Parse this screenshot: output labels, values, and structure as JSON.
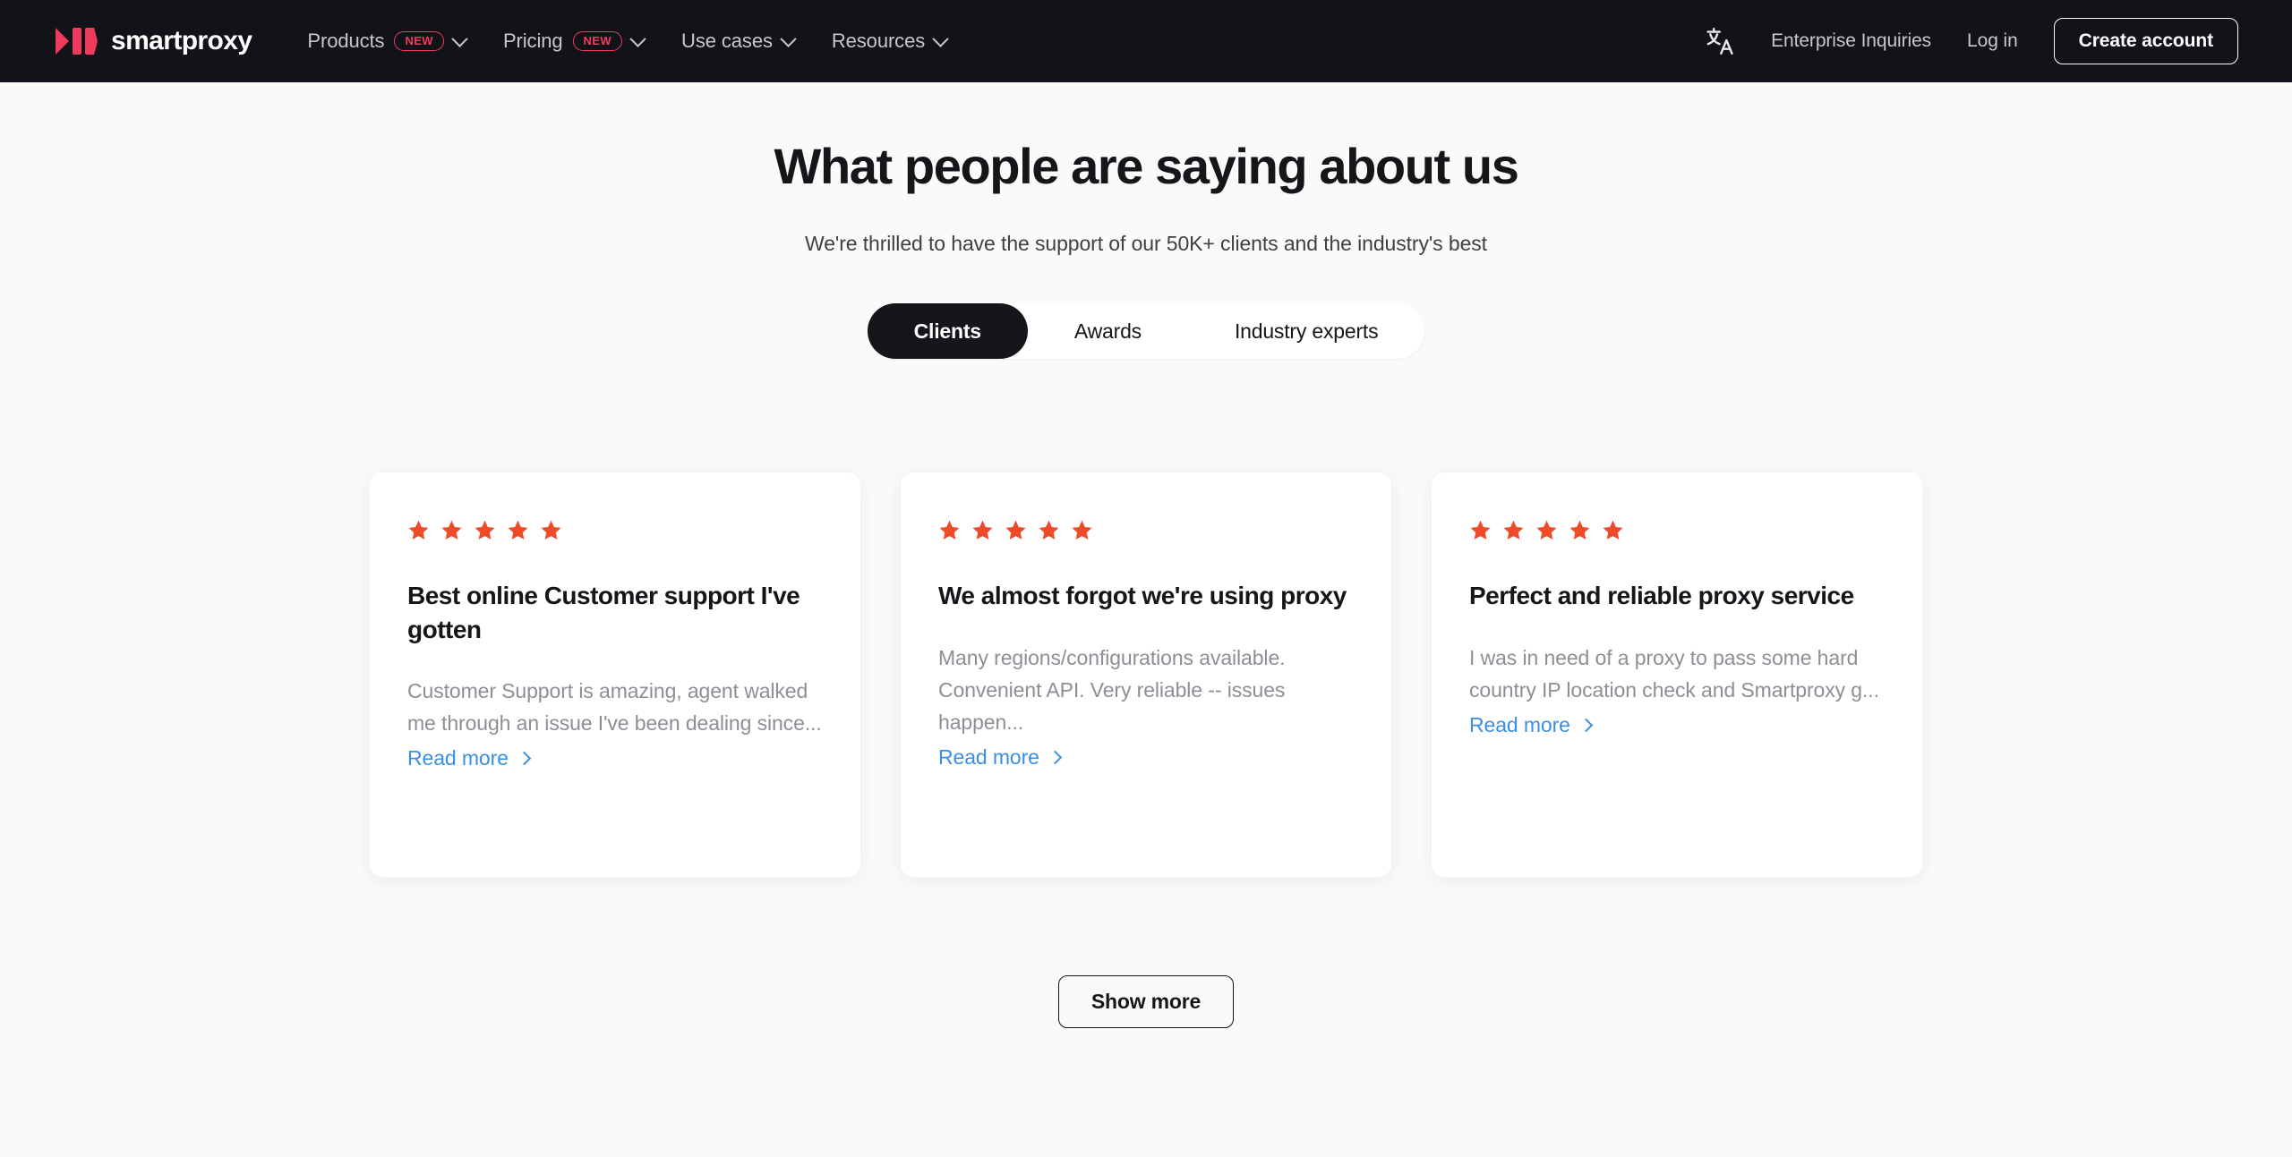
{
  "navbar": {
    "logo_text": "smartproxy",
    "logo_icon": "smartproxy-logo-mark",
    "menu": [
      {
        "label": "Products",
        "badge": "NEW",
        "has_chevron": true
      },
      {
        "label": "Pricing",
        "badge": "NEW",
        "has_chevron": true
      },
      {
        "label": "Use cases",
        "badge": "",
        "has_chevron": true
      },
      {
        "label": "Resources",
        "badge": "",
        "has_chevron": true
      }
    ],
    "language_icon": "translate-icon",
    "enterprise_link": "Enterprise Inquiries",
    "login_link": "Log in",
    "create_account_button": "Create account",
    "background_color": "#121318",
    "accent_color": "#EE3A5B"
  },
  "main": {
    "title": "What people are saying about us",
    "subtitle": "We're thrilled to have the support of our 50K+ clients and the industry's best",
    "tabs": [
      {
        "label": "Clients",
        "active": true
      },
      {
        "label": "Awards",
        "active": false
      },
      {
        "label": "Industry experts",
        "active": false
      }
    ],
    "cards": [
      {
        "rating": 5,
        "title": "Best online Customer support I've gotten",
        "body": "Customer Support is amazing, agent walked me through an issue I've been dealing since...",
        "link": "Read more"
      },
      {
        "rating": 5,
        "title": "We almost forgot we're using proxy",
        "body": "Many regions/configurations available. Convenient API. Very reliable -- issues happen...",
        "link": "Read more"
      },
      {
        "rating": 5,
        "title": "Perfect and reliable proxy service",
        "body": "I was in need of a proxy to pass some hard country IP location check and Smartproxy g...",
        "link": "Read more"
      }
    ],
    "show_more_button": "Show more",
    "star_color": "#F04B28",
    "link_color": "#3B8FE0",
    "page_background": "#FAFAFA"
  }
}
